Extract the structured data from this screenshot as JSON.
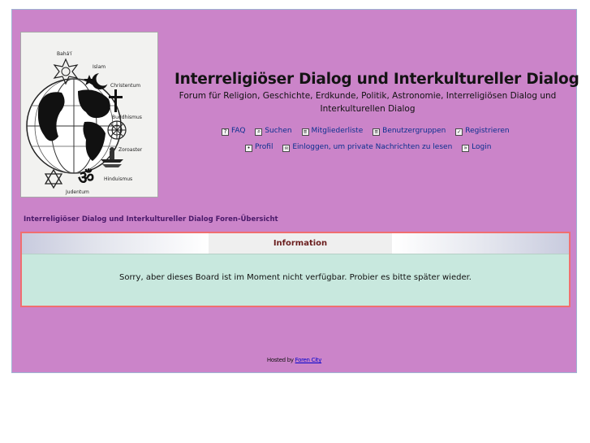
{
  "header": {
    "title": "Interreligiöser Dialog und Interkultureller Dialog",
    "description_line1": "Forum für Religion, Geschichte, Erdkunde, Politik, Astronomie, Interreligiösen Dialog und",
    "description_line2": "Interkulturellen Dialog"
  },
  "logo": {
    "labels": {
      "bahai": "Bahá'í",
      "islam": "Islam",
      "christentum": "Christentum",
      "buddhismus": "Buddhismus",
      "zoroaster": "Zoroaster",
      "hinduismus": "Hinduismus",
      "judentum": "Judentum"
    }
  },
  "nav": {
    "row1": [
      {
        "label": "FAQ",
        "icon": "faq-icon"
      },
      {
        "label": "Suchen",
        "icon": "search-icon"
      },
      {
        "label": "Mitgliederliste",
        "icon": "memberlist-icon"
      },
      {
        "label": "Benutzergruppen",
        "icon": "usergroups-icon"
      },
      {
        "label": "Registrieren",
        "icon": "register-icon"
      }
    ],
    "row2": [
      {
        "label": "Profil",
        "icon": "profile-icon"
      },
      {
        "label": "Einloggen, um private Nachrichten zu lesen",
        "icon": "messages-icon"
      },
      {
        "label": "Login",
        "icon": "login-icon"
      }
    ]
  },
  "breadcrumb": "Interreligiöser Dialog und Interkultureller Dialog Foren-Übersicht",
  "info": {
    "header": "Information",
    "message": "Sorry, aber dieses Board ist im Moment nicht verfügbar. Probier es bitte später wieder."
  },
  "footer": {
    "prefix": "Hosted by ",
    "link": "Foren City"
  },
  "colors": {
    "page_background": "#cb84c9",
    "info_border": "#f06f70",
    "info_body": "#c8e8de",
    "link": "#0a2f8f"
  }
}
